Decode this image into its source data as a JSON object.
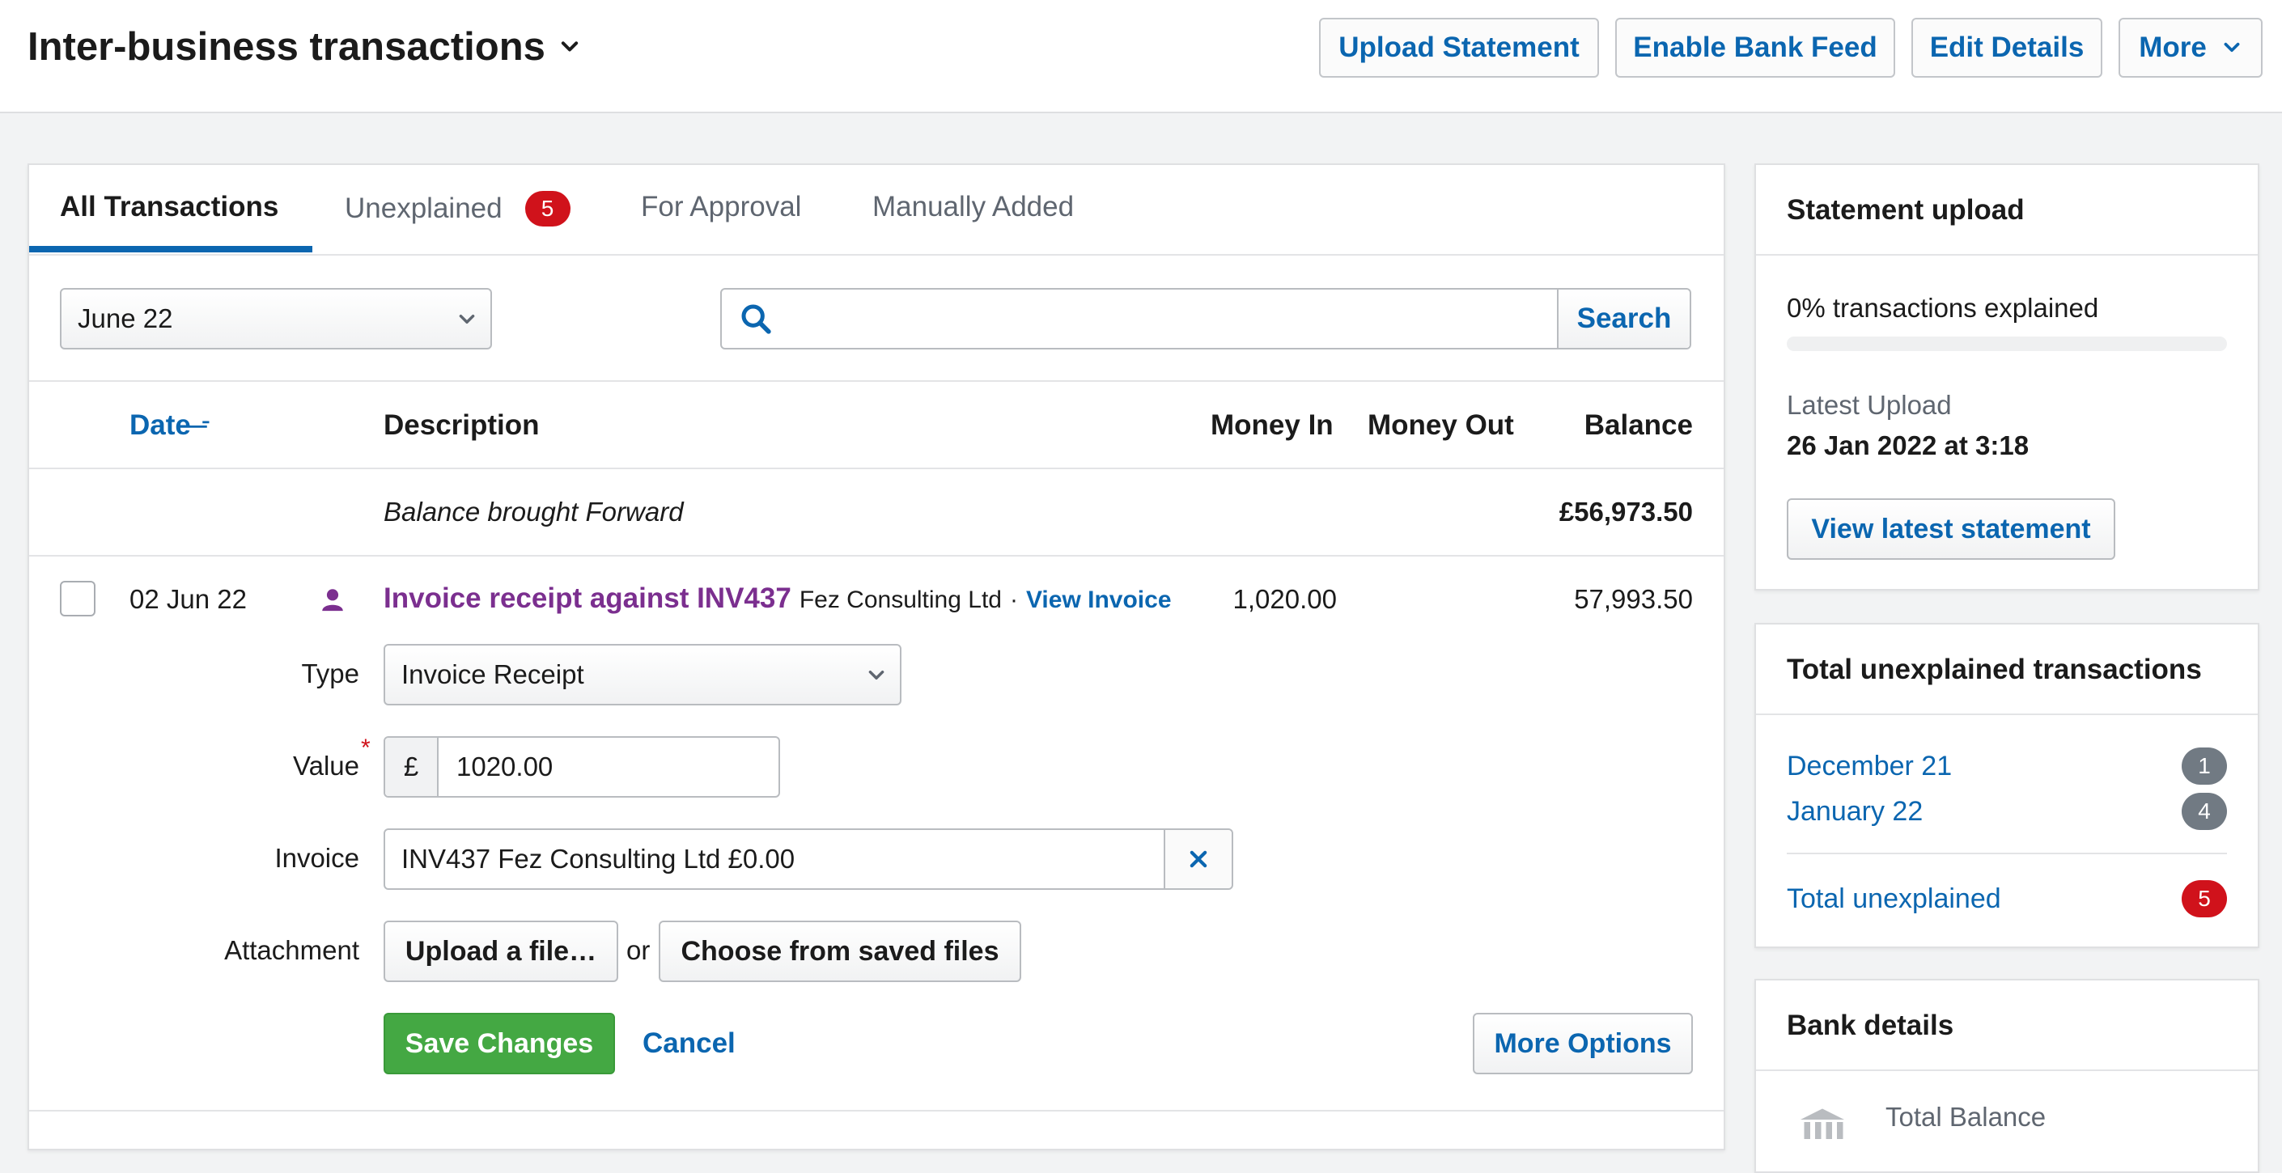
{
  "header": {
    "title": "Inter-business transactions",
    "buttons": {
      "upload_statement": "Upload Statement",
      "enable_bank_feed": "Enable Bank Feed",
      "edit_details": "Edit Details",
      "more": "More"
    }
  },
  "tabs": [
    {
      "label": "All Transactions",
      "active": true
    },
    {
      "label": "Unexplained",
      "badge": "5"
    },
    {
      "label": "For Approval"
    },
    {
      "label": "Manually Added"
    }
  ],
  "filters": {
    "month_selected": "June 22",
    "search_value": "",
    "search_button": "Search"
  },
  "table": {
    "headers": {
      "date": "Date",
      "description": "Description",
      "money_in": "Money In",
      "money_out": "Money Out",
      "balance": "Balance"
    },
    "brought_forward": {
      "label": "Balance brought Forward",
      "balance": "£56,973.50"
    },
    "row": {
      "date": "02 Jun 22",
      "description_link": "Invoice receipt against INV437",
      "company": "Fez Consulting Ltd",
      "separator": "·",
      "view_invoice": "View Invoice",
      "money_in": "1,020.00",
      "money_out": "",
      "balance": "57,993.50"
    }
  },
  "form": {
    "type_label": "Type",
    "type_value": "Invoice Receipt",
    "value_label": "Value",
    "required_mark": "*",
    "currency_symbol": "£",
    "value": "1020.00",
    "invoice_label": "Invoice",
    "invoice_value": "INV437 Fez Consulting Ltd £0.00",
    "attachment_label": "Attachment",
    "upload_button": "Upload a file…",
    "or_text": "or",
    "choose_saved_button": "Choose from saved files",
    "save_button": "Save Changes",
    "cancel_link": "Cancel",
    "more_options_button": "More Options"
  },
  "statement_upload": {
    "title": "Statement upload",
    "progress_text": "0% transactions explained",
    "progress_fraction": 0,
    "latest_label": "Latest Upload",
    "latest_value": "26 Jan 2022 at 3:18",
    "view_button": "View latest statement"
  },
  "unexplained": {
    "title": "Total unexplained transactions",
    "items": [
      {
        "label": "December 21",
        "count": "1"
      },
      {
        "label": "January 22",
        "count": "4"
      }
    ],
    "total_label": "Total unexplained",
    "total_count": "5"
  },
  "bank_details": {
    "title": "Bank details",
    "total_balance_label": "Total Balance"
  },
  "colors": {
    "link_blue": "#0b66b0",
    "badge_red": "#d0121b",
    "badge_gray": "#717a83",
    "save_green": "#44a843",
    "purple": "#7b2f8f"
  }
}
